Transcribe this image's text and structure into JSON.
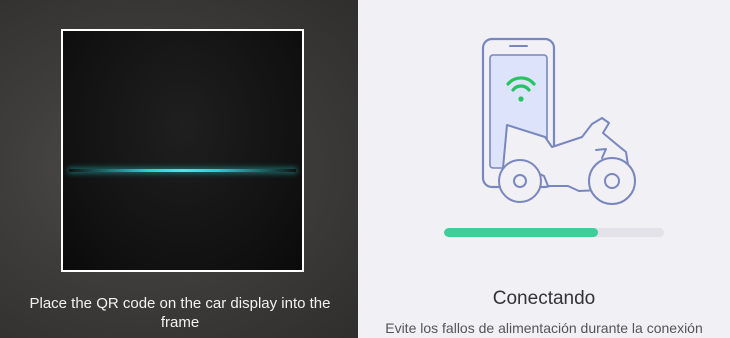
{
  "scanner": {
    "instruction": "Place the QR code on the car display into the frame",
    "accent_color": "#2bd0d3"
  },
  "connection": {
    "title": "Conectando",
    "hint": "Evite los fallos de alimentación durante la conexión",
    "progress_percent": 70,
    "progress_color": "#3ccf9a",
    "wifi_color": "#22c55e",
    "illustration_icons": [
      "smartphone-icon",
      "wifi-icon",
      "motorcycle-icon"
    ]
  }
}
